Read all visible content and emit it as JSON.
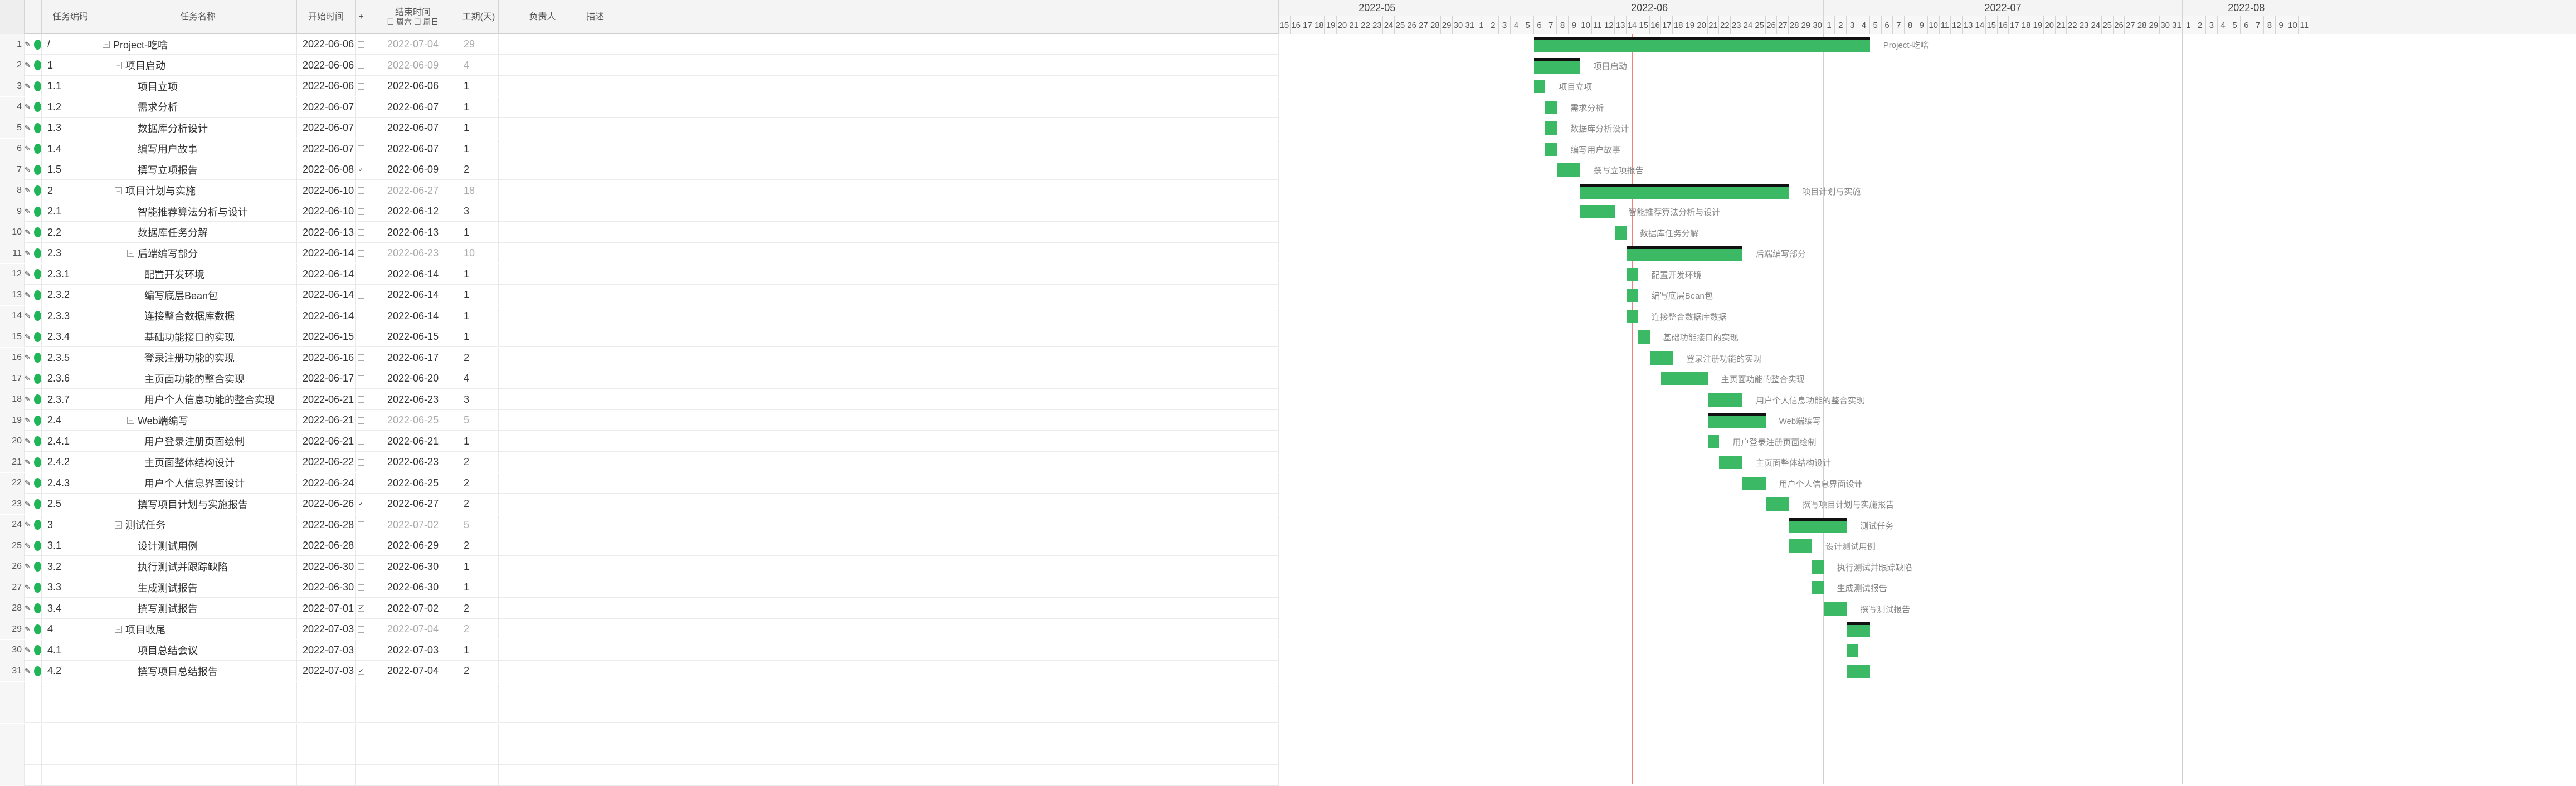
{
  "columns": {
    "code": "任务编码",
    "name": "任务名称",
    "start": "开始时间",
    "add": "+",
    "end_line1": "结束时间",
    "end_line2": "☐ 周六 ☐ 周日",
    "duration": "工期(天)",
    "owner": "负责人",
    "desc": "描述"
  },
  "timeline": {
    "months": [
      {
        "label": "2022-05",
        "days": [
          15,
          16,
          17,
          18,
          19,
          20,
          21,
          22,
          23,
          24,
          25,
          26,
          27,
          28,
          29,
          30,
          31
        ]
      },
      {
        "label": "2022-06",
        "days": [
          1,
          2,
          3,
          4,
          5,
          6,
          7,
          8,
          9,
          10,
          11,
          12,
          13,
          14,
          15,
          16,
          17,
          18,
          19,
          20,
          21,
          22,
          23,
          24,
          25,
          26,
          27,
          28,
          29,
          30
        ]
      },
      {
        "label": "2022-07",
        "days": [
          1,
          2,
          3,
          4,
          5,
          6,
          7,
          8,
          9,
          10,
          11,
          12,
          13,
          14,
          15,
          16,
          17,
          18,
          19,
          20,
          21,
          22,
          23,
          24,
          25,
          26,
          27,
          28,
          29,
          30,
          31
        ]
      },
      {
        "label": "2022-08",
        "days": [
          1,
          2,
          3,
          4,
          5,
          6,
          7,
          8,
          9,
          10,
          11
        ]
      }
    ],
    "today": "2022-06-14"
  },
  "tasks": [
    {
      "num": "1",
      "code": "/",
      "name": "Project-吃啥",
      "level": 0,
      "toggle": "−",
      "start": "2022-06-06",
      "end": "2022-07-04",
      "dur": "29",
      "summary": true,
      "check": false,
      "s": "2022-06-06",
      "e": "2022-07-04"
    },
    {
      "num": "2",
      "code": "1",
      "name": "项目启动",
      "level": 1,
      "toggle": "−",
      "start": "2022-06-06",
      "end": "2022-06-09",
      "dur": "4",
      "summary": true,
      "check": false,
      "s": "2022-06-06",
      "e": "2022-06-09"
    },
    {
      "num": "3",
      "code": "1.1",
      "name": "项目立项",
      "level": 2,
      "toggle": "",
      "start": "2022-06-06",
      "end": "2022-06-06",
      "dur": "1",
      "summary": false,
      "check": false,
      "s": "2022-06-06",
      "e": "2022-06-06"
    },
    {
      "num": "4",
      "code": "1.2",
      "name": "需求分析",
      "level": 2,
      "toggle": "",
      "start": "2022-06-07",
      "end": "2022-06-07",
      "dur": "1",
      "summary": false,
      "check": false,
      "s": "2022-06-07",
      "e": "2022-06-07"
    },
    {
      "num": "5",
      "code": "1.3",
      "name": "数据库分析设计",
      "level": 2,
      "toggle": "",
      "start": "2022-06-07",
      "end": "2022-06-07",
      "dur": "1",
      "summary": false,
      "check": false,
      "s": "2022-06-07",
      "e": "2022-06-07"
    },
    {
      "num": "6",
      "code": "1.4",
      "name": "编写用户故事",
      "level": 2,
      "toggle": "",
      "start": "2022-06-07",
      "end": "2022-06-07",
      "dur": "1",
      "summary": false,
      "check": false,
      "s": "2022-06-07",
      "e": "2022-06-07"
    },
    {
      "num": "7",
      "code": "1.5",
      "name": "撰写立项报告",
      "level": 2,
      "toggle": "",
      "start": "2022-06-08",
      "end": "2022-06-09",
      "dur": "2",
      "summary": false,
      "check": true,
      "s": "2022-06-08",
      "e": "2022-06-09"
    },
    {
      "num": "8",
      "code": "2",
      "name": "项目计划与实施",
      "level": 1,
      "toggle": "−",
      "start": "2022-06-10",
      "end": "2022-06-27",
      "dur": "18",
      "summary": true,
      "check": false,
      "s": "2022-06-10",
      "e": "2022-06-27"
    },
    {
      "num": "9",
      "code": "2.1",
      "name": "智能推荐算法分析与设计",
      "level": 2,
      "toggle": "",
      "start": "2022-06-10",
      "end": "2022-06-12",
      "dur": "3",
      "summary": false,
      "check": false,
      "s": "2022-06-10",
      "e": "2022-06-12"
    },
    {
      "num": "10",
      "code": "2.2",
      "name": "数据库任务分解",
      "level": 2,
      "toggle": "",
      "start": "2022-06-13",
      "end": "2022-06-13",
      "dur": "1",
      "summary": false,
      "check": false,
      "s": "2022-06-13",
      "e": "2022-06-13"
    },
    {
      "num": "11",
      "code": "2.3",
      "name": "后端编写部分",
      "level": 2,
      "toggle": "−",
      "start": "2022-06-14",
      "end": "2022-06-23",
      "dur": "10",
      "summary": true,
      "check": false,
      "s": "2022-06-14",
      "e": "2022-06-23"
    },
    {
      "num": "12",
      "code": "2.3.1",
      "name": "配置开发环境",
      "level": 3,
      "toggle": "",
      "start": "2022-06-14",
      "end": "2022-06-14",
      "dur": "1",
      "summary": false,
      "check": false,
      "s": "2022-06-14",
      "e": "2022-06-14"
    },
    {
      "num": "13",
      "code": "2.3.2",
      "name": "编写底层Bean包",
      "level": 3,
      "toggle": "",
      "start": "2022-06-14",
      "end": "2022-06-14",
      "dur": "1",
      "summary": false,
      "check": false,
      "s": "2022-06-14",
      "e": "2022-06-14"
    },
    {
      "num": "14",
      "code": "2.3.3",
      "name": "连接整合数据库数据",
      "level": 3,
      "toggle": "",
      "start": "2022-06-14",
      "end": "2022-06-14",
      "dur": "1",
      "summary": false,
      "check": false,
      "s": "2022-06-14",
      "e": "2022-06-14"
    },
    {
      "num": "15",
      "code": "2.3.4",
      "name": "基础功能接口的实现",
      "level": 3,
      "toggle": "",
      "start": "2022-06-15",
      "end": "2022-06-15",
      "dur": "1",
      "summary": false,
      "check": false,
      "s": "2022-06-15",
      "e": "2022-06-15"
    },
    {
      "num": "16",
      "code": "2.3.5",
      "name": "登录注册功能的实现",
      "level": 3,
      "toggle": "",
      "start": "2022-06-16",
      "end": "2022-06-17",
      "dur": "2",
      "summary": false,
      "check": false,
      "s": "2022-06-16",
      "e": "2022-06-17"
    },
    {
      "num": "17",
      "code": "2.3.6",
      "name": "主页面功能的整合实现",
      "level": 3,
      "toggle": "",
      "start": "2022-06-17",
      "end": "2022-06-20",
      "dur": "4",
      "summary": false,
      "check": false,
      "s": "2022-06-17",
      "e": "2022-06-20"
    },
    {
      "num": "18",
      "code": "2.3.7",
      "name": "用户个人信息功能的整合实现",
      "level": 3,
      "toggle": "",
      "start": "2022-06-21",
      "end": "2022-06-23",
      "dur": "3",
      "summary": false,
      "check": false,
      "s": "2022-06-21",
      "e": "2022-06-23"
    },
    {
      "num": "19",
      "code": "2.4",
      "name": "Web端编写",
      "level": 2,
      "toggle": "−",
      "start": "2022-06-21",
      "end": "2022-06-25",
      "dur": "5",
      "summary": true,
      "check": false,
      "s": "2022-06-21",
      "e": "2022-06-25"
    },
    {
      "num": "20",
      "code": "2.4.1",
      "name": "用户登录注册页面绘制",
      "level": 3,
      "toggle": "",
      "start": "2022-06-21",
      "end": "2022-06-21",
      "dur": "1",
      "summary": false,
      "check": false,
      "s": "2022-06-21",
      "e": "2022-06-21"
    },
    {
      "num": "21",
      "code": "2.4.2",
      "name": "主页面整体结构设计",
      "level": 3,
      "toggle": "",
      "start": "2022-06-22",
      "end": "2022-06-23",
      "dur": "2",
      "summary": false,
      "check": false,
      "s": "2022-06-22",
      "e": "2022-06-23"
    },
    {
      "num": "22",
      "code": "2.4.3",
      "name": "用户个人信息界面设计",
      "level": 3,
      "toggle": "",
      "start": "2022-06-24",
      "end": "2022-06-25",
      "dur": "2",
      "summary": false,
      "check": false,
      "s": "2022-06-24",
      "e": "2022-06-25"
    },
    {
      "num": "23",
      "code": "2.5",
      "name": "撰写项目计划与实施报告",
      "level": 2,
      "toggle": "",
      "start": "2022-06-26",
      "end": "2022-06-27",
      "dur": "2",
      "summary": false,
      "check": true,
      "s": "2022-06-26",
      "e": "2022-06-27"
    },
    {
      "num": "24",
      "code": "3",
      "name": "测试任务",
      "level": 1,
      "toggle": "−",
      "start": "2022-06-28",
      "end": "2022-07-02",
      "dur": "5",
      "summary": true,
      "check": false,
      "s": "2022-06-28",
      "e": "2022-07-02"
    },
    {
      "num": "25",
      "code": "3.1",
      "name": "设计测试用例",
      "level": 2,
      "toggle": "",
      "start": "2022-06-28",
      "end": "2022-06-29",
      "dur": "2",
      "summary": false,
      "check": false,
      "s": "2022-06-28",
      "e": "2022-06-29"
    },
    {
      "num": "26",
      "code": "3.2",
      "name": "执行测试并跟踪缺陷",
      "level": 2,
      "toggle": "",
      "start": "2022-06-30",
      "end": "2022-06-30",
      "dur": "1",
      "summary": false,
      "check": false,
      "s": "2022-06-30",
      "e": "2022-06-30"
    },
    {
      "num": "27",
      "code": "3.3",
      "name": "生成测试报告",
      "level": 2,
      "toggle": "",
      "start": "2022-06-30",
      "end": "2022-06-30",
      "dur": "1",
      "summary": false,
      "check": false,
      "s": "2022-06-30",
      "e": "2022-06-30"
    },
    {
      "num": "28",
      "code": "3.4",
      "name": "撰写测试报告",
      "level": 2,
      "toggle": "",
      "start": "2022-07-01",
      "end": "2022-07-02",
      "dur": "2",
      "summary": false,
      "check": true,
      "s": "2022-07-01",
      "e": "2022-07-02"
    },
    {
      "num": "29",
      "code": "4",
      "name": "项目收尾",
      "level": 1,
      "toggle": "−",
      "start": "2022-07-03",
      "end": "2022-07-04",
      "dur": "2",
      "summary": true,
      "check": false,
      "s": "2022-07-03",
      "e": "2022-07-04"
    },
    {
      "num": "30",
      "code": "4.1",
      "name": "项目总结会议",
      "level": 2,
      "toggle": "",
      "start": "2022-07-03",
      "end": "2022-07-03",
      "dur": "1",
      "summary": false,
      "check": false,
      "s": "2022-07-03",
      "e": "2022-07-03"
    },
    {
      "num": "31",
      "code": "4.2",
      "name": "撰写项目总结报告",
      "level": 2,
      "toggle": "",
      "start": "2022-07-03",
      "end": "2022-07-04",
      "dur": "2",
      "summary": false,
      "check": true,
      "s": "2022-07-03",
      "e": "2022-07-04"
    }
  ],
  "bar_labels_hidden_from_gantt": [
    "项目收尾",
    "项目总结会议",
    "撰写项目总结报告"
  ]
}
